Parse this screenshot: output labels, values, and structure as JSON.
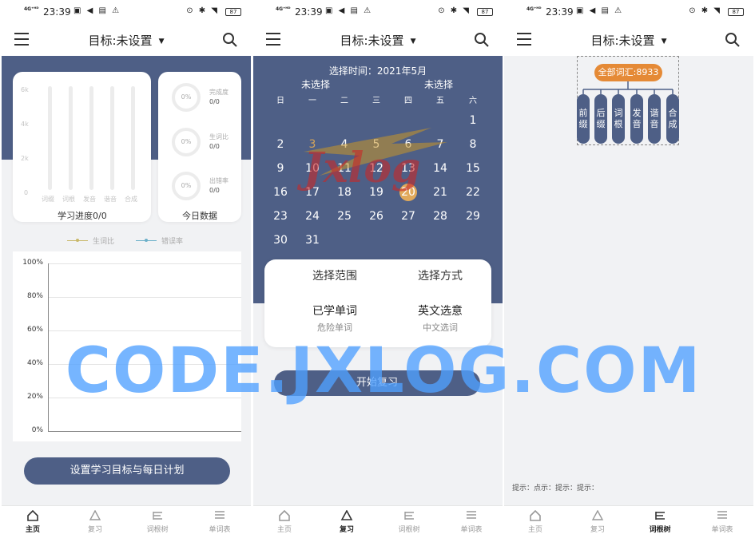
{
  "status": {
    "signal": "4G⁺ᴴᴰ",
    "time": "23:39",
    "noti_icons": "▣ ◀ ▤ ⚠",
    "sys_icons": "⊙ ✱ ◥",
    "battery": "87"
  },
  "appbar": {
    "title": "目标:未设置"
  },
  "nav": [
    "主页",
    "复习",
    "词根树",
    "单词表"
  ],
  "home": {
    "y_ticks": [
      "6k",
      "4k",
      "2k",
      "0"
    ],
    "bar_categories": [
      "词缀",
      "词根",
      "发音",
      "谐音",
      "合成"
    ],
    "progress_label": "学习进度0/0",
    "today_label": "今日数据",
    "metrics": [
      {
        "ring": "0%",
        "name": "完成度",
        "value": "0/0"
      },
      {
        "ring": "0%",
        "name": "生词比",
        "value": "0/0"
      },
      {
        "ring": "0%",
        "name": "出错率",
        "value": "0/0"
      }
    ],
    "legend": [
      {
        "name": "生词比",
        "color": "#c9b86a"
      },
      {
        "name": "错误率",
        "color": "#6cb0c9"
      }
    ],
    "line_ticks": [
      "100%",
      "80%",
      "60%",
      "40%",
      "20%",
      "0%"
    ],
    "plan_button": "设置学习目标与每日计划"
  },
  "review": {
    "select_time": "选择时间：2021年5月",
    "unselected_left": "未选择",
    "unselected_right": "未选择",
    "weekdays": [
      "日",
      "一",
      "二",
      "三",
      "四",
      "五",
      "六"
    ],
    "days": [
      "1",
      "2",
      "3",
      "4",
      "5",
      "6",
      "7",
      "8",
      "9",
      "10",
      "11",
      "12",
      "13",
      "14",
      "15",
      "16",
      "17",
      "18",
      "19",
      "20",
      "21",
      "22",
      "23",
      "24",
      "25",
      "26",
      "27",
      "28",
      "29",
      "30",
      "31"
    ],
    "today": "20",
    "opt_range": "选择范围",
    "opt_mode": "选择方式",
    "opt_learned": "已学单词",
    "opt_en": "英文选意",
    "opt_danger": "危险单词",
    "opt_cn": "中文选词",
    "start_button": "开始复习"
  },
  "tree": {
    "root": "全部词汇:8933",
    "leaves": [
      "前缀",
      "后缀",
      "词根",
      "发音",
      "谐音",
      "合成"
    ],
    "hint": "提示：点示：提示：提示："
  },
  "watermark": "CODE.JXLOG.COM",
  "logo_text": "Jxlog"
}
